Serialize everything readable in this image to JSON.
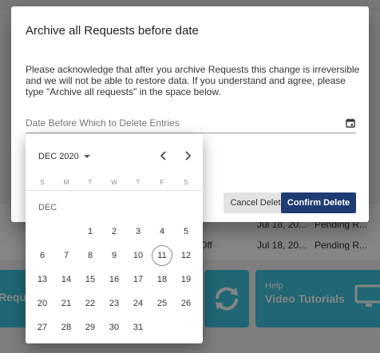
{
  "background": {
    "rows": [
      {
        "col1": "Off",
        "col2": "Jul 18, 20...",
        "col3": "Pending R..."
      },
      {
        "col1": "",
        "col2": "Jul 18, 20...",
        "col3": "Pending R..."
      }
    ],
    "tiles": [
      {
        "label_small": "",
        "label_big": "Reque"
      },
      {
        "label_small": "Help",
        "label_big": "Video Tutorials"
      }
    ]
  },
  "dialog": {
    "title": "Archive all Requests before date",
    "message": "Please acknowledge that after you archive Requests this change is irreversible and we will not be able to restore data. If you understand and agree, please type \"Archive all requests\" in the space below.",
    "date_placeholder": "Date Before Which to Delete Entries",
    "cancel_label": "Cancel Delete",
    "confirm_label": "Confirm Delete"
  },
  "calendar": {
    "month_select": "DEC 2020",
    "month_label": "DEC",
    "weekdays": [
      "S",
      "M",
      "T",
      "W",
      "T",
      "F",
      "S"
    ],
    "today": "11",
    "weeks": [
      [
        "",
        "",
        "1",
        "2",
        "3",
        "4",
        "5"
      ],
      [
        "6",
        "7",
        "8",
        "9",
        "10",
        "11",
        "12"
      ],
      [
        "13",
        "14",
        "15",
        "16",
        "17",
        "18",
        "19"
      ],
      [
        "20",
        "21",
        "22",
        "23",
        "24",
        "25",
        "26"
      ],
      [
        "27",
        "28",
        "29",
        "30",
        "31",
        "",
        ""
      ]
    ]
  }
}
